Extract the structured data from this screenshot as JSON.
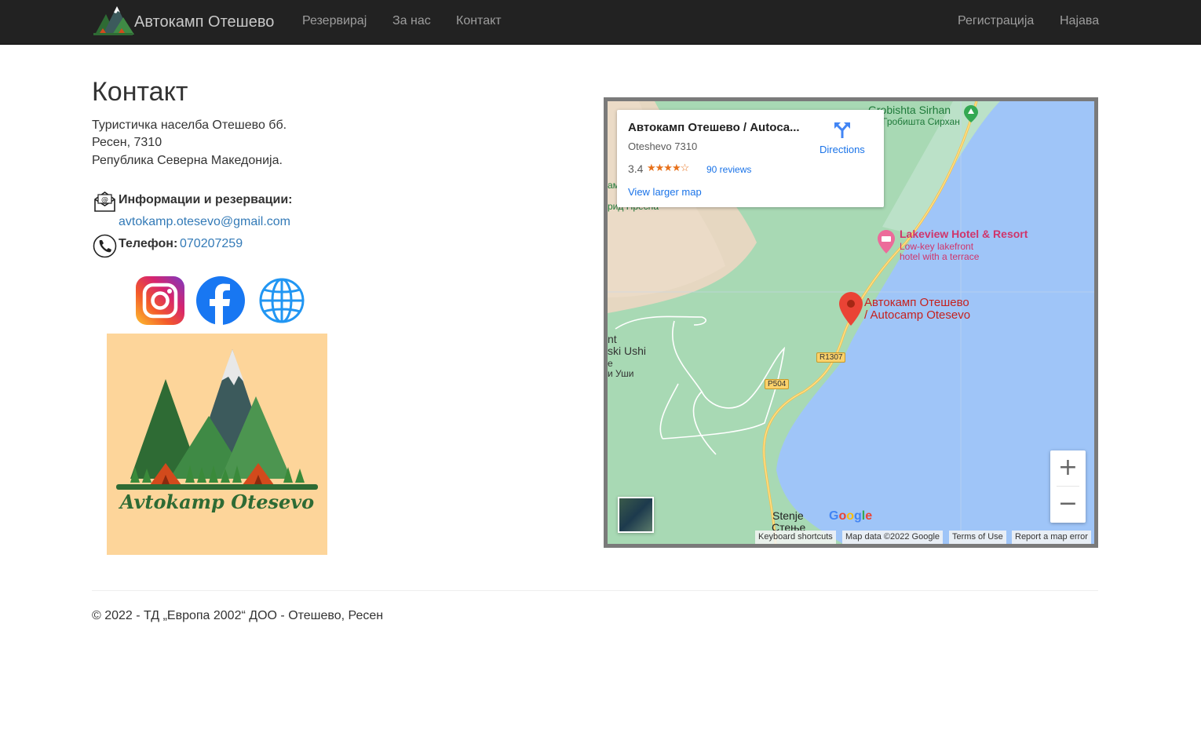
{
  "nav": {
    "brand": "Автокамп Отешево",
    "brand_logo_text": "Avtokamp Otesevo",
    "links": [
      "Резервирај",
      "За нас",
      "Контакт"
    ],
    "register": "Регистрација",
    "login": "Најава"
  },
  "contact": {
    "title": "Контакт",
    "address": [
      "Туристичка населба Отешево бб.",
      "Ресен, 7310",
      "Република Северна Македонија."
    ],
    "info_label": "Информации и резервации:",
    "email": "avtokamp.otesevo@gmail.com",
    "phone_label": "Телефон:",
    "phone": "070207259"
  },
  "social": [
    "instagram-icon",
    "facebook-icon",
    "globe-icon"
  ],
  "logo": {
    "text": "Avtokamp Otesevo"
  },
  "map": {
    "card_title": "Автокамп Отешево / Autoca...",
    "card_subtitle": "Oteshevo 7310",
    "rating": "3.4",
    "stars": "★★★★☆",
    "reviews": "90 reviews",
    "larger_map": "View larger map",
    "directions": "Directions",
    "labels": {
      "grobishta": "Grobishta Sirhan",
      "grobishta_cyr": "Гробишта Сирхан",
      "lakeview": "Lakeview Hotel & Resort",
      "lakeview_desc1": "Low-key lakefront",
      "lakeview_desc2": "hotel with a terrace",
      "camp1": "Автокамп Отешево",
      "camp2": "/ Autocamp Otesevo",
      "ushi1": "nt",
      "ushi2": "ski Ushi",
      "ushi3": "е",
      "ushi4": "и Уши",
      "presa": "рид Пресна",
      "am": "ам",
      "stenje": "Stenje",
      "stenje_cyr": "Стење",
      "r1307": "R1307",
      "p504": "P504",
      "google": "Google"
    },
    "footer": [
      "Keyboard shortcuts",
      "Map data ©2022 Google",
      "Terms of Use",
      "Report a map error"
    ],
    "zoom_in": "+",
    "zoom_out": "−"
  },
  "footer": {
    "copyright": "© 2022 - ТД „Европа 2002“ ДОО - Отешево, Ресен"
  },
  "colors": {
    "navbar": "#222222",
    "link": "#337ab7",
    "logo_bg": "#fdd59a",
    "lake": "#9fc5f8",
    "land": "#a8d9b4"
  }
}
